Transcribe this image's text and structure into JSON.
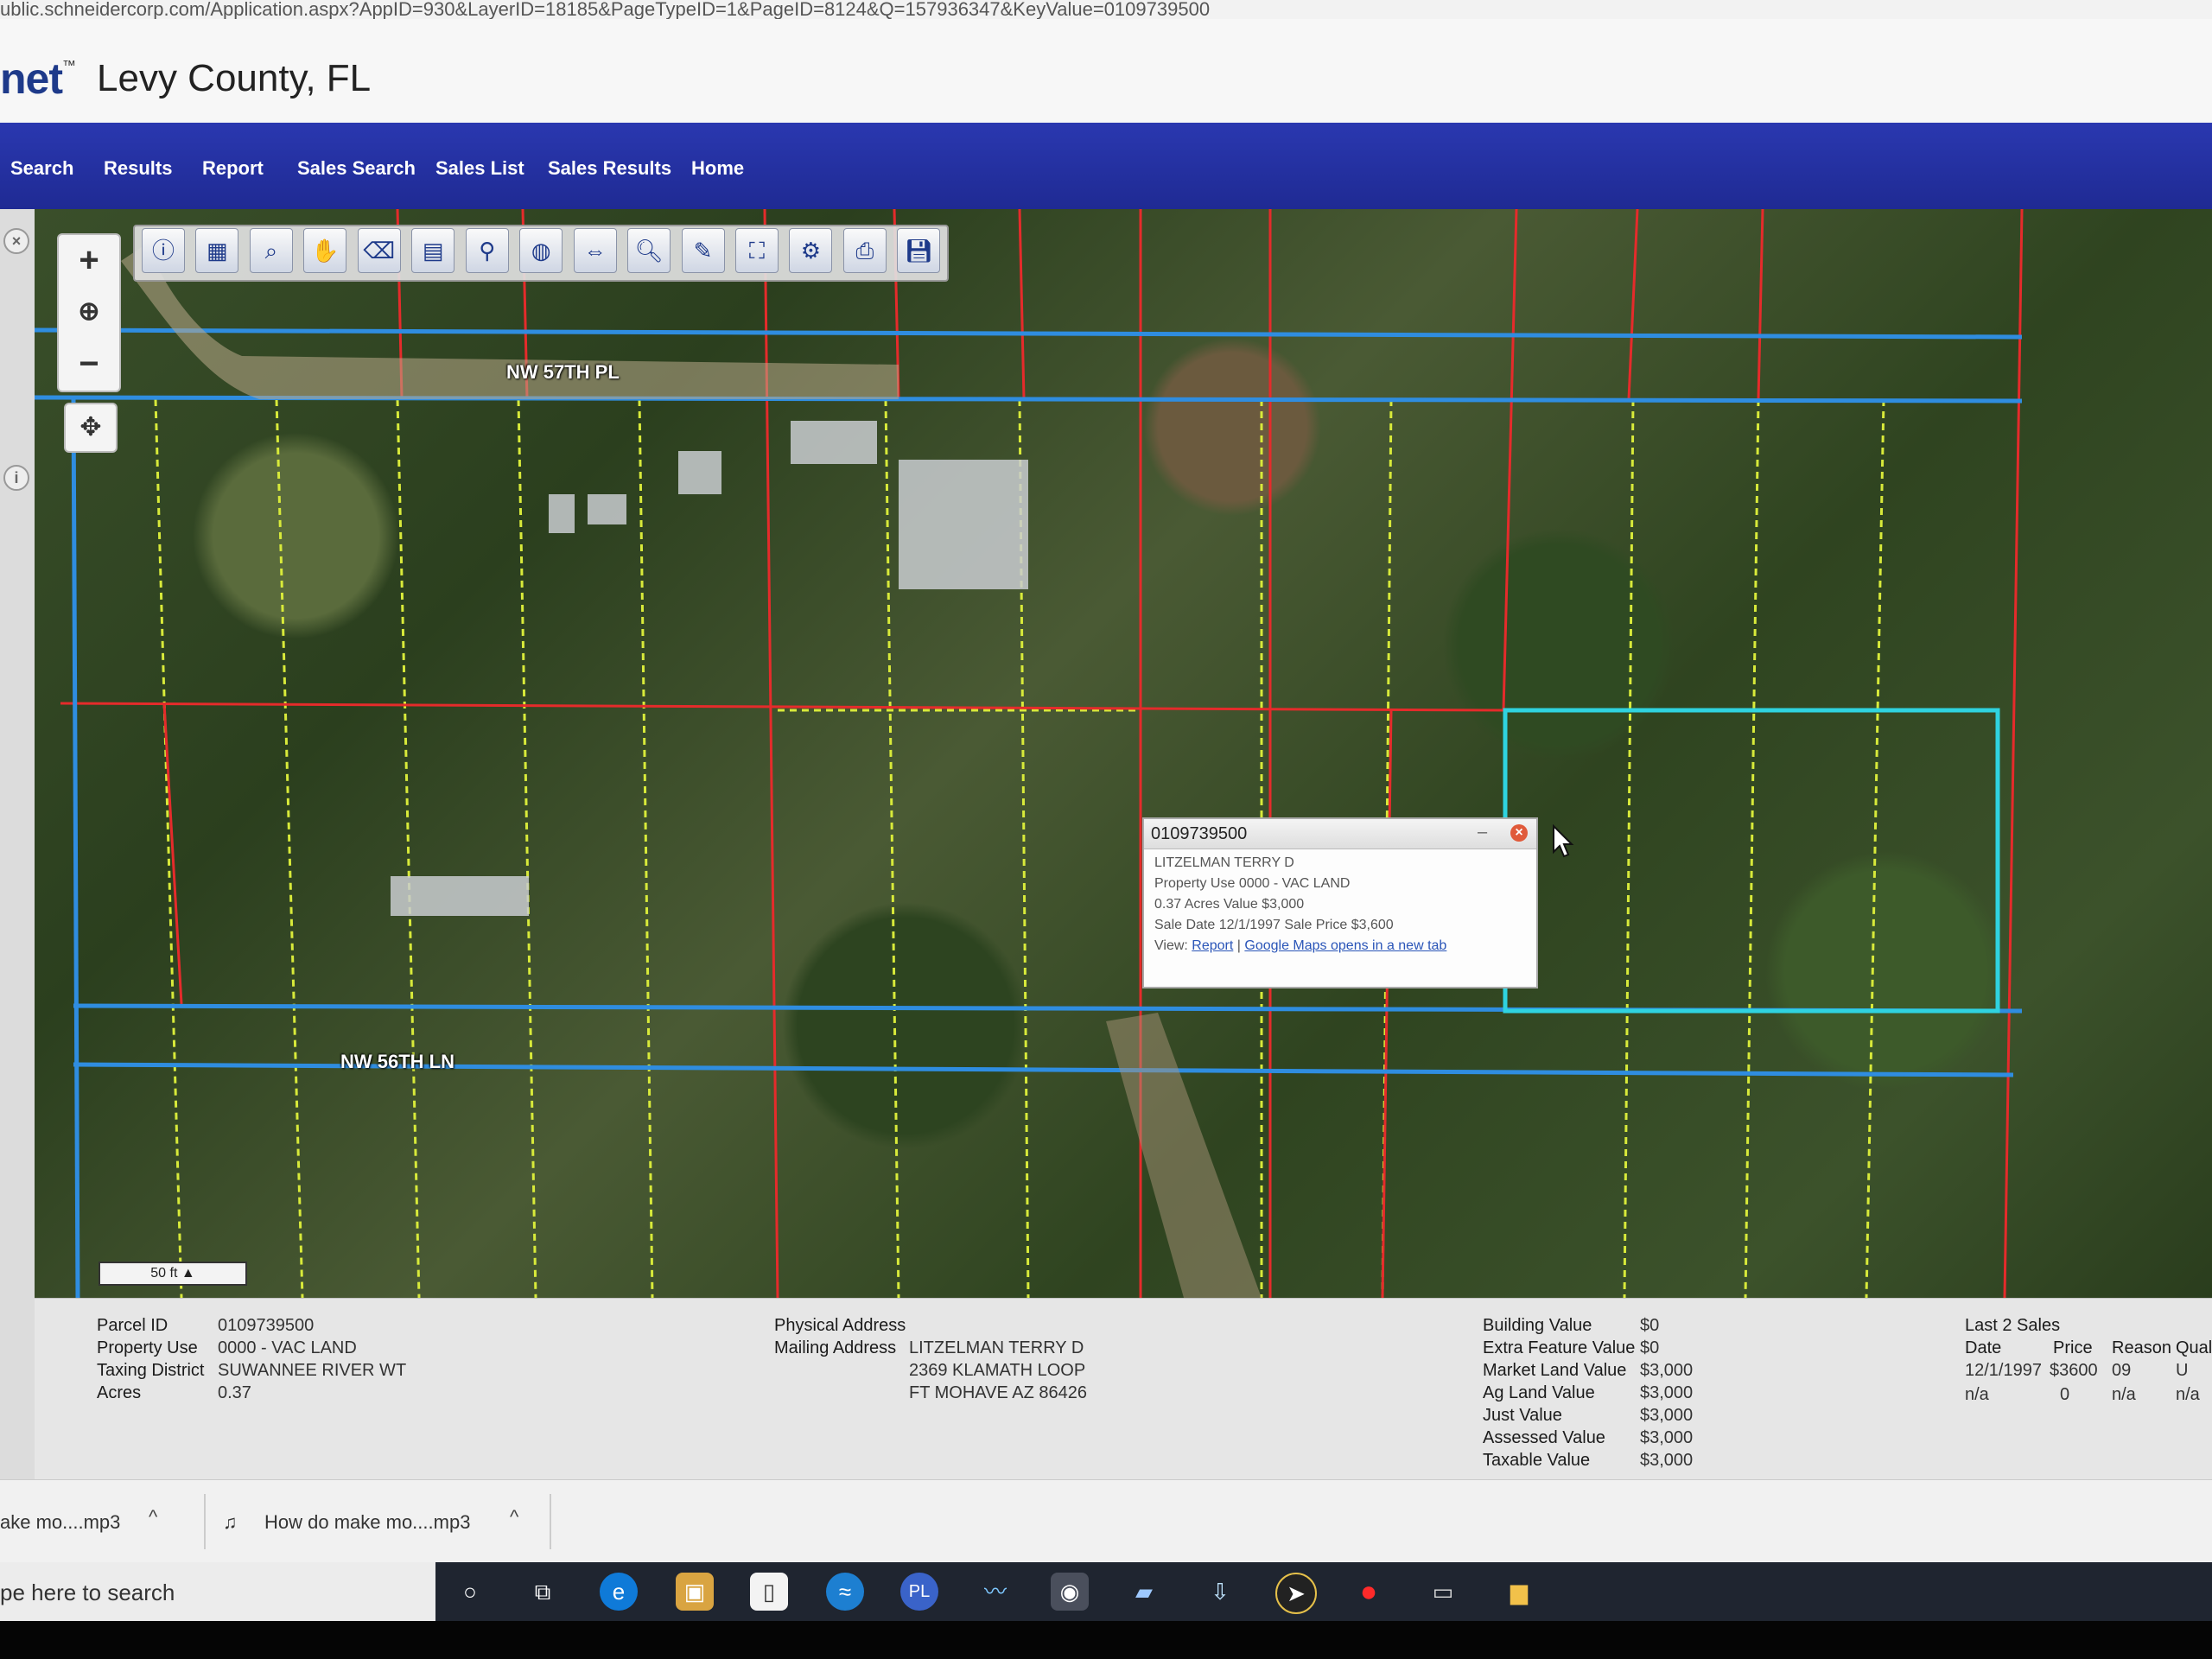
{
  "browser": {
    "url": "ublic.schneidercorp.com/Application.aspx?AppID=930&LayerID=18185&PageTypeID=1&PageID=8124&Q=157936347&KeyValue=0109739500"
  },
  "header": {
    "brand": "net",
    "brand_mark": "™",
    "county": "Levy County, FL"
  },
  "nav": {
    "items": [
      "Search",
      "Results",
      "Report",
      "Sales Search",
      "Sales List",
      "Sales Results",
      "Home"
    ]
  },
  "map": {
    "road_labels": [
      "NW 57TH PL",
      "NW 56TH LN"
    ],
    "scale_label": "50 ft",
    "zoom_in": "+",
    "zoom_out": "−",
    "globe": "⊕",
    "pan": "✥"
  },
  "popup": {
    "title": "0109739500",
    "owner": "LITZELMAN TERRY D",
    "property_use": "Property Use 0000 - VAC LAND",
    "acres_value": "0.37 Acres  Value $3,000",
    "sale": "Sale Date 12/1/1997 Sale Price $3,600",
    "view_label": "View:",
    "link_report": "Report",
    "link_sep": "|",
    "link_gmaps": "Google Maps opens in a new tab"
  },
  "info": {
    "left": [
      {
        "label": "Parcel ID",
        "value": "0109739500"
      },
      {
        "label": "Property Use",
        "value": "0000 - VAC LAND"
      },
      {
        "label": "Taxing District",
        "value": "SUWANNEE RIVER WT"
      },
      {
        "label": "Acres",
        "value": "0.37"
      }
    ],
    "physical_address_label": "Physical Address",
    "mailing_address_label": "Mailing Address",
    "mailing_lines": [
      "LITZELMAN TERRY D",
      "2369 KLAMATH LOOP",
      "FT MOHAVE AZ 86426"
    ],
    "values": [
      {
        "label": "Building Value",
        "value": "$0"
      },
      {
        "label": "Extra Feature Value",
        "value": "$0"
      },
      {
        "label": "Market Land Value",
        "value": "$3,000"
      },
      {
        "label": "Ag Land Value",
        "value": "$3,000"
      },
      {
        "label": "Just Value",
        "value": "$3,000"
      },
      {
        "label": "Assessed Value",
        "value": "$3,000"
      },
      {
        "label": "Taxable Value",
        "value": "$3,000"
      }
    ],
    "sales_title": "Last 2 Sales",
    "sales_headers": [
      "Date",
      "Price",
      "Reason",
      "Qual"
    ],
    "sales_rows": [
      [
        "12/1/1997",
        "$3600",
        "09",
        "U"
      ],
      [
        "n/a",
        "0",
        "n/a",
        "n/a"
      ]
    ]
  },
  "downloads": {
    "items": [
      "ake mo....mp3",
      "How do make mo....mp3"
    ],
    "chevron": "^"
  },
  "taskbar": {
    "search_placeholder": "pe here to search",
    "icons": [
      "cortana-icon",
      "task-view-icon",
      "edge-icon",
      "store-icon",
      "file-icon",
      "app-icon",
      "pl-icon",
      "wave-icon",
      "chrome-icon",
      "notes-icon",
      "download-icon",
      "cursor-app-icon",
      "record-icon",
      "screen-icon",
      "folder-icon"
    ]
  },
  "colors": {
    "nav": "#1f2a93",
    "parcel_line_red": "#e52b2b",
    "lot_line_yellow": "#d8ea3a",
    "road_line_blue": "#2f8de0",
    "selected_parcel_cyan": "#2fd3e0"
  }
}
